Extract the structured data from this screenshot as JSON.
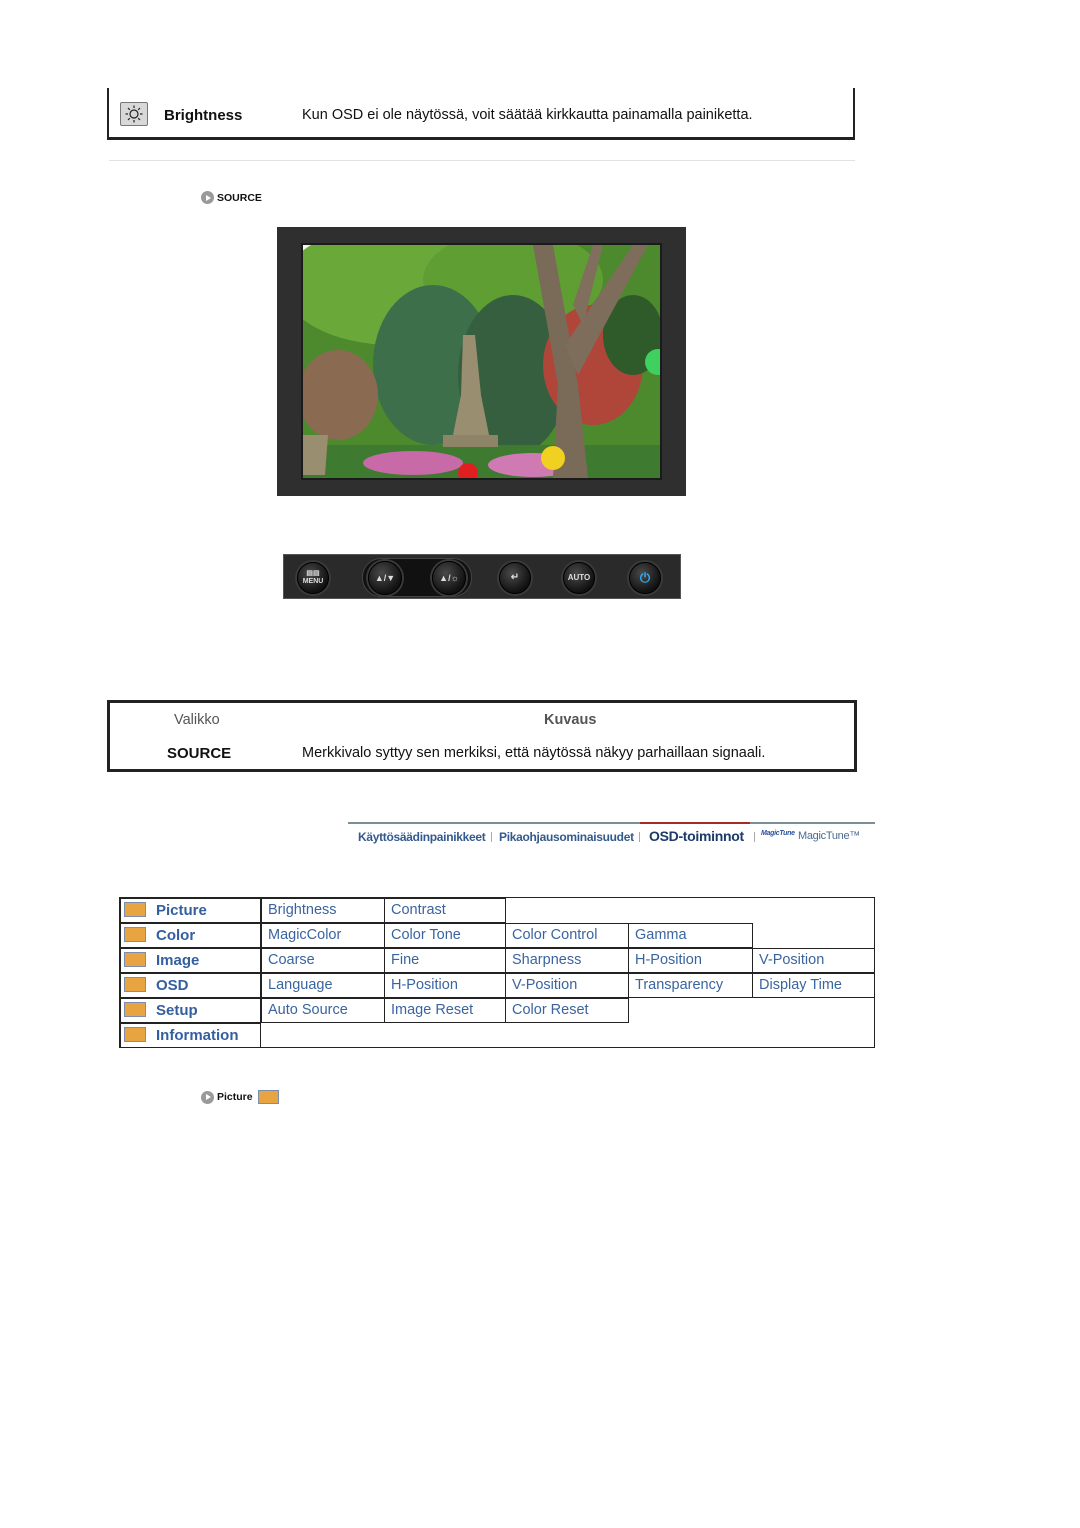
{
  "brightness_row": {
    "icon": "brightness-sun-icon",
    "label": "Brightness",
    "description": "Kun OSD ei ole näytössä, voit säätää kirkkautta painamalla painiketta."
  },
  "source_link": {
    "icon": "circle-arrow-icon",
    "label": "SOURCE"
  },
  "monitor_image": {
    "description": "Garden with stone pagoda, trees and lanterns displayed on monitor"
  },
  "control_panel": {
    "buttons": [
      {
        "name": "menu",
        "label": "MENU",
        "icon": "menu-icon"
      },
      {
        "name": "magicbright-down",
        "label": "",
        "icon": "magicbright-down-icon"
      },
      {
        "name": "up-brightness",
        "label": "",
        "icon": "up-brightness-icon"
      },
      {
        "name": "enter-source",
        "label": "",
        "icon": "enter-icon"
      },
      {
        "name": "auto",
        "label": "AUTO",
        "icon": "auto-icon"
      },
      {
        "name": "power",
        "label": "",
        "icon": "power-icon"
      }
    ]
  },
  "menu_table": {
    "headers": {
      "menu": "Valikko",
      "description": "Kuvaus"
    },
    "rows": [
      {
        "menu": "SOURCE",
        "description": "Merkkivalo syttyy sen merkiksi, että näytössä näkyy parhaillaan signaali."
      }
    ]
  },
  "nav": {
    "items": [
      {
        "label": "Käyttösäädinpainikkeet",
        "active": false
      },
      {
        "label": "Pikaohjausominaisuudet",
        "active": false
      },
      {
        "label": "OSD-toiminnot",
        "active": true
      },
      {
        "label": "MagicTune™",
        "active": false
      }
    ],
    "magictune_logo": "MagicTune",
    "active_color": "#a52a2a",
    "line_color": "#7a8f98"
  },
  "osd_grid": {
    "categories": [
      {
        "label": "Picture",
        "icon": "picture-icon",
        "items": [
          "Brightness",
          "Contrast"
        ]
      },
      {
        "label": "Color",
        "icon": "color-icon",
        "items": [
          "MagicColor",
          "Color Tone",
          "Color Control",
          "Gamma"
        ]
      },
      {
        "label": "Image",
        "icon": "image-icon",
        "items": [
          "Coarse",
          "Fine",
          "Sharpness",
          "H-Position",
          "V-Position"
        ]
      },
      {
        "label": "OSD",
        "icon": "osd-icon",
        "items": [
          "Language",
          "H-Position",
          "V-Position",
          "Transparency",
          "Display Time"
        ]
      },
      {
        "label": "Setup",
        "icon": "setup-icon",
        "items": [
          "Auto Source",
          "Image Reset",
          "Color Reset"
        ]
      },
      {
        "label": "Information",
        "icon": "information-icon",
        "items": []
      }
    ],
    "link_color": "#3a64a0"
  },
  "picture_link": {
    "icon": "circle-arrow-icon",
    "label": "Picture",
    "trailing_icon": "picture-icon"
  }
}
